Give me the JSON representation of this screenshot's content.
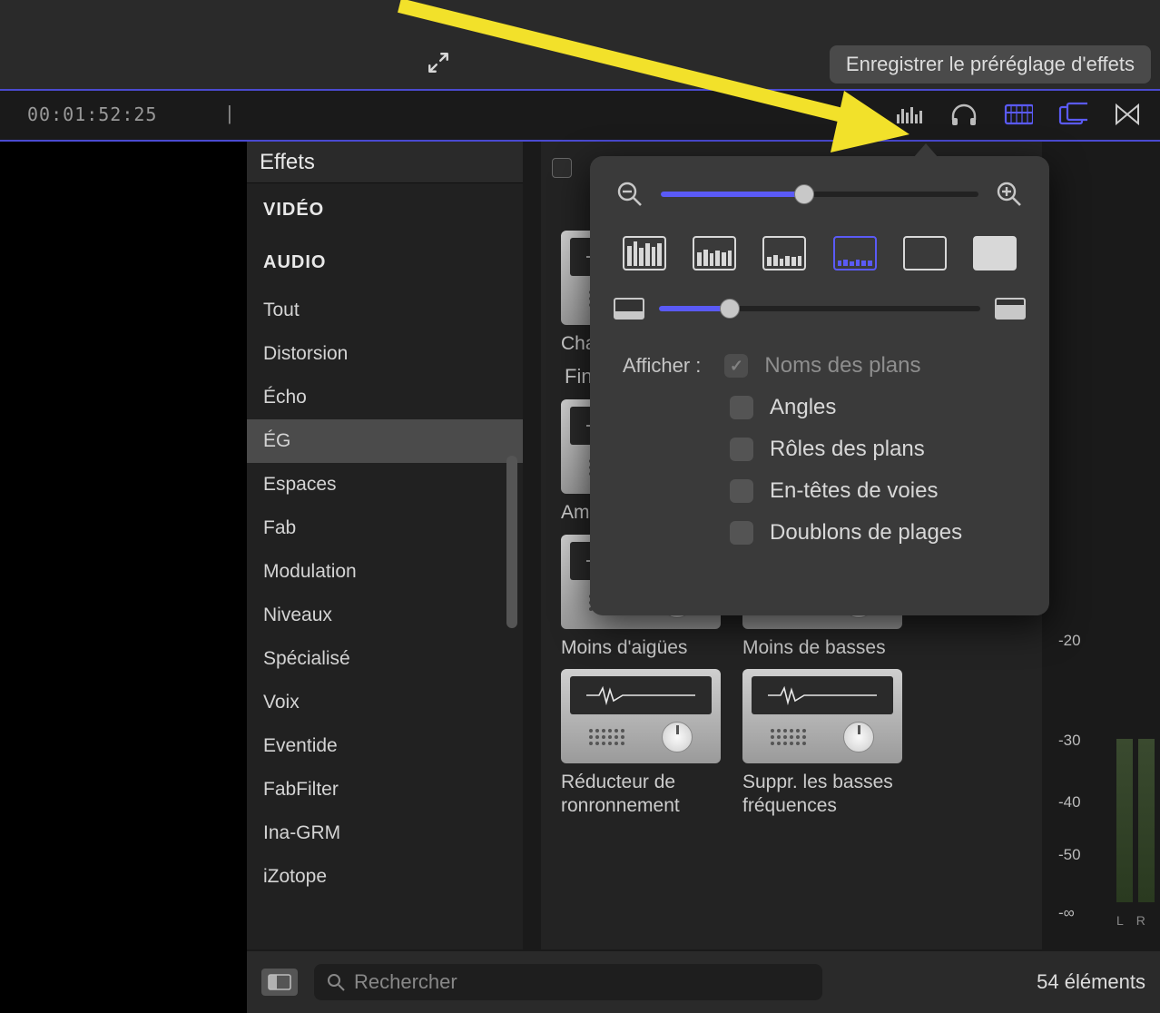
{
  "toolbar": {
    "tooltip": "Enregistrer le préréglage d'effets",
    "timecode": "00:01:52:25"
  },
  "effects": {
    "title": "Effets",
    "cat_video": "VIDÉO",
    "cat_audio": "AUDIO",
    "items": [
      {
        "label": "Tout"
      },
      {
        "label": "Distorsion"
      },
      {
        "label": "Écho"
      },
      {
        "label": "ÉG",
        "selected": true
      },
      {
        "label": "Espaces"
      },
      {
        "label": "Fab"
      },
      {
        "label": "Modulation"
      },
      {
        "label": "Niveaux"
      },
      {
        "label": "Spécialisé"
      },
      {
        "label": "Voix"
      },
      {
        "label": "Eventide"
      },
      {
        "label": "FabFilter"
      },
      {
        "label": "Ina-GRM"
      },
      {
        "label": "iZotope"
      }
    ]
  },
  "grid": {
    "section_cha": "Cha",
    "section_fin": "Fin",
    "cards": {
      "amel_basses": "Amél \nbass",
      "moins_aigues": "Moins d'aigües",
      "moins_basses": "Moins de basses",
      "reducteur": "Réducteur de ronronnement",
      "suppr_basses": "Suppr. les basses fréquences"
    }
  },
  "popover": {
    "show_label": "Afficher :",
    "options": [
      {
        "label": "Noms des plans",
        "checked": true,
        "disabled": true
      },
      {
        "label": "Angles",
        "checked": false
      },
      {
        "label": "Rôles des plans",
        "checked": false
      },
      {
        "label": "En-têtes de voies",
        "checked": false
      },
      {
        "label": "Doublons de plages",
        "checked": false
      }
    ],
    "zoom_slider_pct": 45,
    "height_slider_pct": 22
  },
  "footer": {
    "search_placeholder": "Rechercher",
    "count": "54 éléments"
  },
  "meter": {
    "ticks": [
      "-20",
      "-30",
      "-40",
      "-50",
      "-∞"
    ],
    "L": "L",
    "R": "R"
  }
}
